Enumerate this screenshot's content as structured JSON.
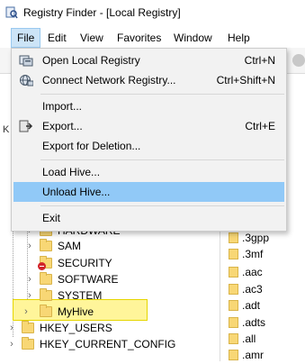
{
  "window": {
    "title": "Registry Finder - [Local Registry]"
  },
  "menubar": {
    "items": [
      {
        "label": "File",
        "active": true
      },
      {
        "label": "Edit"
      },
      {
        "label": "View"
      },
      {
        "label": "Favorites"
      },
      {
        "label": "Window"
      },
      {
        "label": "Help"
      }
    ]
  },
  "file_menu": {
    "items": [
      {
        "label": "Open Local Registry",
        "shortcut": "Ctrl+N",
        "icon": "registry-icon"
      },
      {
        "label": "Connect Network Registry...",
        "shortcut": "Ctrl+Shift+N",
        "icon": "network-icon"
      },
      {
        "label": "Import...",
        "shortcut": ""
      },
      {
        "label": "Export...",
        "shortcut": "Ctrl+E",
        "icon": "export-icon"
      },
      {
        "label": "Export for Deletion...",
        "shortcut": ""
      },
      {
        "label": "Load Hive...",
        "shortcut": ""
      },
      {
        "label": "Unload Hive...",
        "shortcut": "",
        "hover": true
      },
      {
        "label": "Exit",
        "shortcut": ""
      }
    ]
  },
  "tree": {
    "items": [
      {
        "label": "HARDWARE"
      },
      {
        "label": "SAM"
      },
      {
        "label": "SECURITY"
      },
      {
        "label": "SOFTWARE"
      },
      {
        "label": "SYSTEM"
      },
      {
        "label": "MyHive"
      },
      {
        "label": "HKEY_USERS"
      },
      {
        "label": "HKEY_CURRENT_CONFIG"
      }
    ]
  },
  "list": {
    "items": [
      {
        "label": ".3gpp"
      },
      {
        "label": ".3mf"
      },
      {
        "label": ".aac"
      },
      {
        "label": ".ac3"
      },
      {
        "label": ".adt"
      },
      {
        "label": ".adts"
      },
      {
        "label": ".all"
      },
      {
        "label": ".amr"
      }
    ]
  },
  "colors": {
    "menu_active_bg": "#cce4f7",
    "menu_hover_bg": "#91c9f7",
    "highlight_bg": "#fff59a",
    "folder": "#f8d775"
  }
}
